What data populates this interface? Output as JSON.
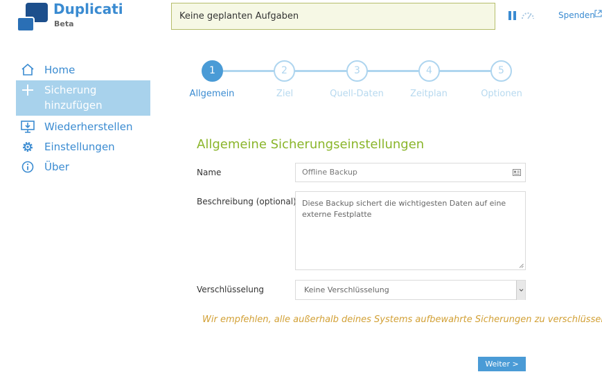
{
  "header": {
    "brand_title": "Duplicati",
    "brand_subtitle": "Beta",
    "status_text": "Keine geplanten Aufgaben",
    "donate_label": "Spenden",
    "accent_color": "#3a8bd1"
  },
  "sidebar": {
    "items": [
      {
        "label": "Home",
        "icon": "home-icon",
        "active": false
      },
      {
        "label": "Sicherung\nhinzufügen",
        "icon": "plus-icon",
        "active": true
      },
      {
        "label": "Wiederherstellen",
        "icon": "restore-icon",
        "active": false
      },
      {
        "label": "Einstellungen",
        "icon": "gear-icon",
        "active": false
      },
      {
        "label": "Über",
        "icon": "info-icon",
        "active": false
      }
    ]
  },
  "wizard": {
    "current_step": 1,
    "steps": [
      {
        "number": "1",
        "label": "Allgemein"
      },
      {
        "number": "2",
        "label": "Ziel"
      },
      {
        "number": "3",
        "label": "Quell-Daten"
      },
      {
        "number": "4",
        "label": "Zeitplan"
      },
      {
        "number": "5",
        "label": "Optionen"
      }
    ]
  },
  "form": {
    "section_title": "Allgemeine Sicherungseinstellungen",
    "name_label": "Name",
    "name_value": "Offline Backup",
    "description_label": "Beschreibung (optional)",
    "description_value": "Diese Backup sichert die wichtigesten Daten auf eine externe Festplatte",
    "encryption_label": "Verschlüsselung",
    "encryption_value": "Keine Verschlüsselung",
    "warning_text": "Wir empfehlen, alle außerhalb deines Systems aufbewahrte Sicherungen zu verschlüsseln",
    "next_label": "Weiter >"
  }
}
